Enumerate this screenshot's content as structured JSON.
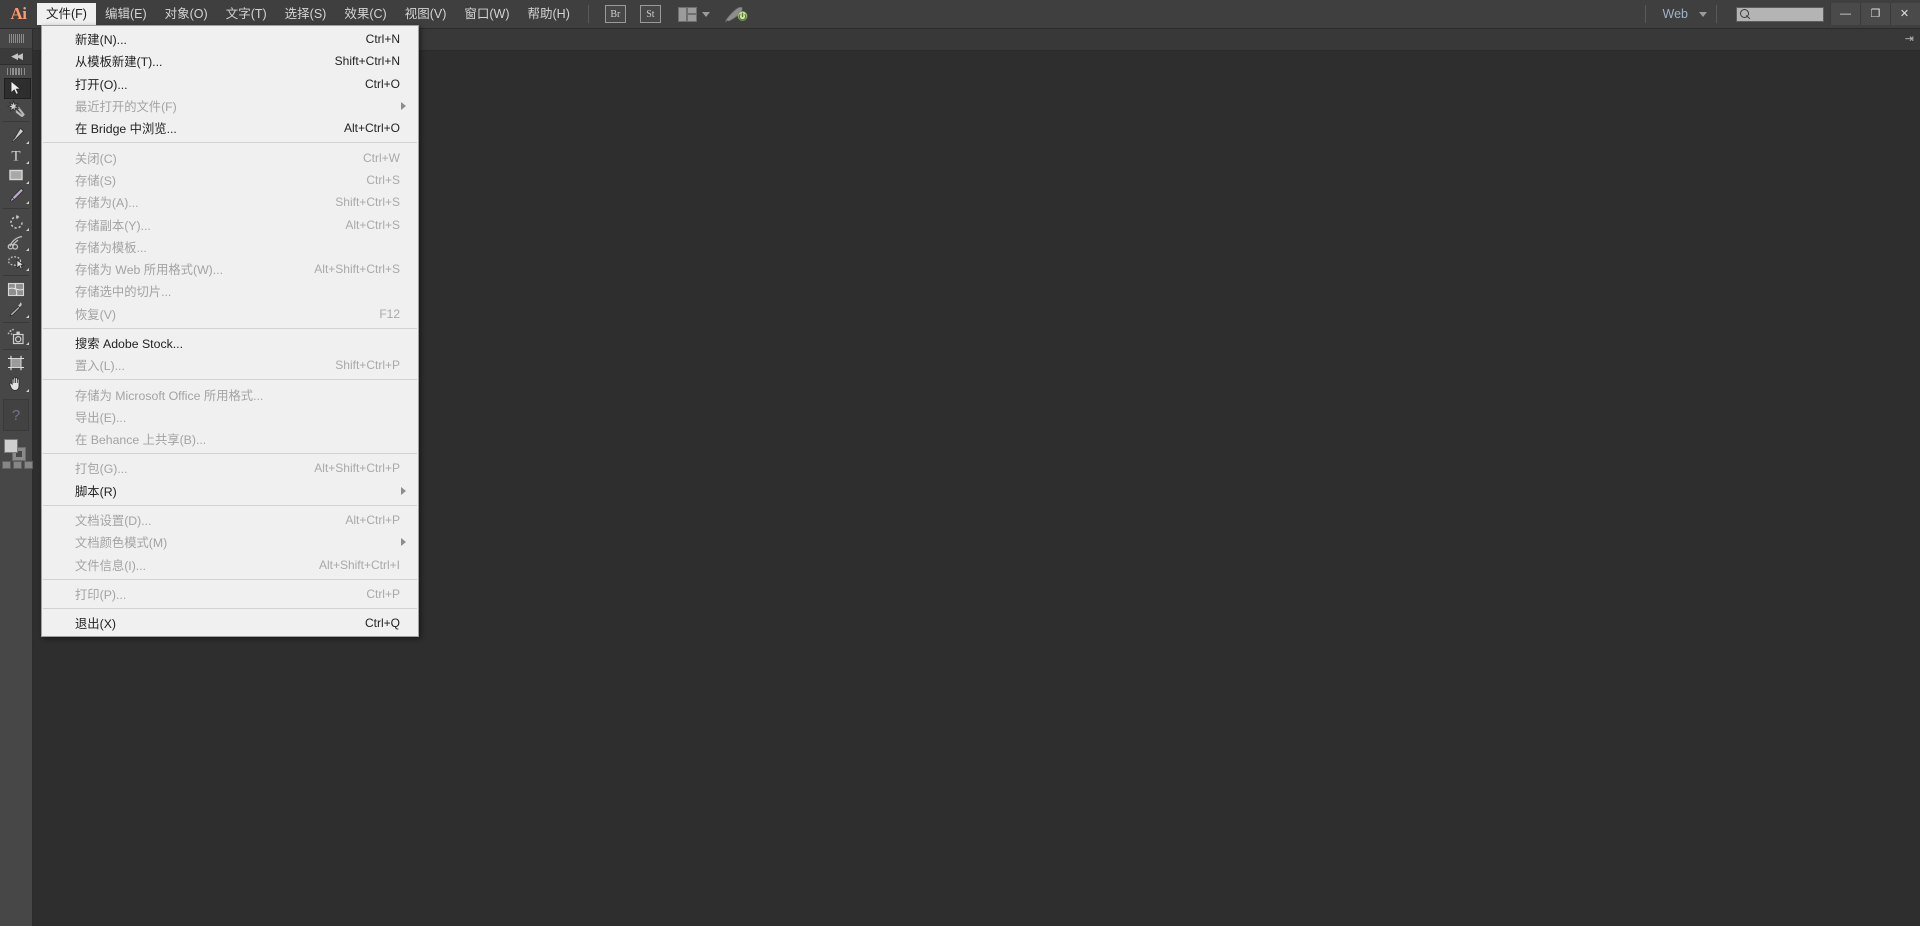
{
  "app": {
    "logo": "Ai",
    "name": "Adobe Illustrator"
  },
  "menubar": {
    "items": [
      {
        "label": "文件(F)",
        "active": true
      },
      {
        "label": "编辑(E)",
        "active": false
      },
      {
        "label": "对象(O)",
        "active": false
      },
      {
        "label": "文字(T)",
        "active": false
      },
      {
        "label": "选择(S)",
        "active": false
      },
      {
        "label": "效果(C)",
        "active": false
      },
      {
        "label": "视图(V)",
        "active": false
      },
      {
        "label": "窗口(W)",
        "active": false
      },
      {
        "label": "帮助(H)",
        "active": false
      }
    ],
    "bridge_button": "Br",
    "stock_button": "St",
    "arrange_icon": "arrange-documents-icon",
    "rocket_icon": "rocket-launch-icon",
    "workspace_label": "Web",
    "search_placeholder": "",
    "search_value": "",
    "window_minimize": "—",
    "window_restore": "❐",
    "window_close": "✕"
  },
  "toolpanel": {
    "tools": [
      {
        "name": "selection-tool",
        "selected": true,
        "has_flyout": false
      },
      {
        "name": "magic-wand-tool",
        "selected": false,
        "has_flyout": false
      },
      {
        "name": "pen-tool",
        "selected": false,
        "has_flyout": true
      },
      {
        "name": "type-tool",
        "selected": false,
        "has_flyout": true
      },
      {
        "name": "rectangle-tool",
        "selected": false,
        "has_flyout": true
      },
      {
        "name": "paintbrush-tool",
        "selected": false,
        "has_flyout": true
      },
      {
        "name": "rotate-tool",
        "selected": false,
        "has_flyout": true
      },
      {
        "name": "scale-shear-tool",
        "selected": false,
        "has_flyout": true
      },
      {
        "name": "shape-builder-tool",
        "selected": false,
        "has_flyout": true
      },
      {
        "name": "mesh-tool",
        "selected": false,
        "has_flyout": false
      },
      {
        "name": "eyedropper-tool",
        "selected": false,
        "has_flyout": true
      },
      {
        "name": "symbol-sprayer-tool",
        "selected": false,
        "has_flyout": true
      },
      {
        "name": "artboard-tool",
        "selected": false,
        "has_flyout": false
      },
      {
        "name": "hand-tool",
        "selected": false,
        "has_flyout": true
      }
    ],
    "help_glyph": "?"
  },
  "file_menu": {
    "groups": [
      [
        {
          "label": "新建(N)...",
          "shortcut": "Ctrl+N",
          "enabled": true,
          "submenu": false
        },
        {
          "label": "从模板新建(T)...",
          "shortcut": "Shift+Ctrl+N",
          "enabled": true,
          "submenu": false
        },
        {
          "label": "打开(O)...",
          "shortcut": "Ctrl+O",
          "enabled": true,
          "submenu": false
        },
        {
          "label": "最近打开的文件(F)",
          "shortcut": "",
          "enabled": false,
          "submenu": true
        },
        {
          "label": "在 Bridge 中浏览...",
          "shortcut": "Alt+Ctrl+O",
          "enabled": true,
          "submenu": false
        }
      ],
      [
        {
          "label": "关闭(C)",
          "shortcut": "Ctrl+W",
          "enabled": false,
          "submenu": false
        },
        {
          "label": "存储(S)",
          "shortcut": "Ctrl+S",
          "enabled": false,
          "submenu": false
        },
        {
          "label": "存储为(A)...",
          "shortcut": "Shift+Ctrl+S",
          "enabled": false,
          "submenu": false
        },
        {
          "label": "存储副本(Y)...",
          "shortcut": "Alt+Ctrl+S",
          "enabled": false,
          "submenu": false
        },
        {
          "label": "存储为模板...",
          "shortcut": "",
          "enabled": false,
          "submenu": false
        },
        {
          "label": "存储为 Web 所用格式(W)...",
          "shortcut": "Alt+Shift+Ctrl+S",
          "enabled": false,
          "submenu": false
        },
        {
          "label": "存储选中的切片...",
          "shortcut": "",
          "enabled": false,
          "submenu": false
        },
        {
          "label": "恢复(V)",
          "shortcut": "F12",
          "enabled": false,
          "submenu": false
        }
      ],
      [
        {
          "label": "搜索 Adobe Stock...",
          "shortcut": "",
          "enabled": true,
          "submenu": false
        },
        {
          "label": "置入(L)...",
          "shortcut": "Shift+Ctrl+P",
          "enabled": false,
          "submenu": false
        }
      ],
      [
        {
          "label": "存储为 Microsoft Office 所用格式...",
          "shortcut": "",
          "enabled": false,
          "submenu": false
        },
        {
          "label": "导出(E)...",
          "shortcut": "",
          "enabled": false,
          "submenu": false
        },
        {
          "label": "在 Behance 上共享(B)...",
          "shortcut": "",
          "enabled": false,
          "submenu": false
        }
      ],
      [
        {
          "label": "打包(G)...",
          "shortcut": "Alt+Shift+Ctrl+P",
          "enabled": false,
          "submenu": false
        },
        {
          "label": "脚本(R)",
          "shortcut": "",
          "enabled": true,
          "submenu": true
        }
      ],
      [
        {
          "label": "文档设置(D)...",
          "shortcut": "Alt+Ctrl+P",
          "enabled": false,
          "submenu": false
        },
        {
          "label": "文档颜色模式(M)",
          "shortcut": "",
          "enabled": false,
          "submenu": true
        },
        {
          "label": "文件信息(I)...",
          "shortcut": "Alt+Shift+Ctrl+I",
          "enabled": false,
          "submenu": false
        }
      ],
      [
        {
          "label": "打印(P)...",
          "shortcut": "Ctrl+P",
          "enabled": false,
          "submenu": false
        }
      ],
      [
        {
          "label": "退出(X)",
          "shortcut": "Ctrl+Q",
          "enabled": true,
          "submenu": false
        }
      ]
    ]
  },
  "colors": {
    "menubar_bg": "#3f3f3f",
    "panel_bg": "#474747",
    "canvas_bg": "#2e2e2e",
    "menu_bg": "#f0f0f0",
    "logo_accent": "#ff9a6e",
    "workspace_accent": "#9fb3c8"
  }
}
